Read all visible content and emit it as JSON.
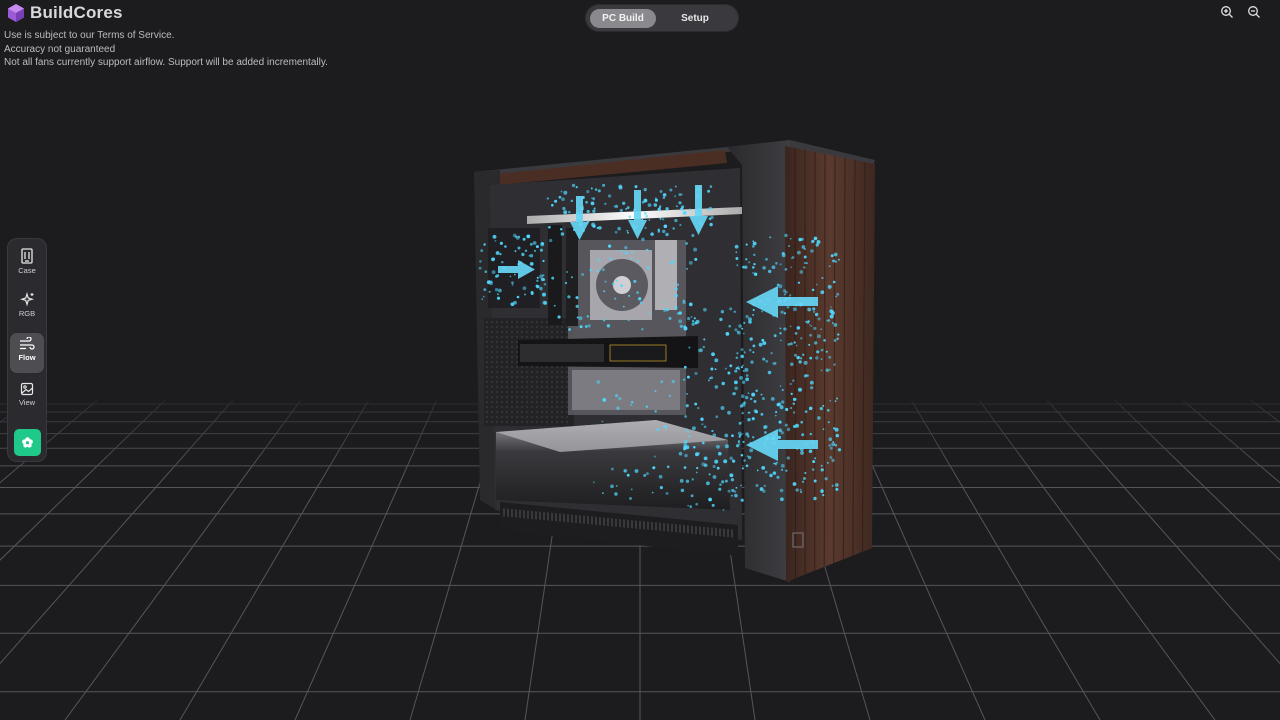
{
  "app": {
    "title": "BuildCores",
    "disclaimers": [
      "Use is subject to our Terms of Service.",
      "Accuracy not guaranteed",
      "Not all fans currently support airflow. Support will be added incrementally."
    ]
  },
  "tabs": [
    {
      "label": "PC Build",
      "active": true
    },
    {
      "label": "Setup",
      "active": false
    }
  ],
  "zoom_controls": {
    "zoom_in_icon": "zoom-in-icon",
    "zoom_out_icon": "zoom-out-icon"
  },
  "toolbar": {
    "items": [
      {
        "label": "Case",
        "icon": "case-icon",
        "active": false
      },
      {
        "label": "RGB",
        "icon": "sparkle-icon",
        "active": false
      },
      {
        "label": "Flow",
        "icon": "wind-icon",
        "active": true
      },
      {
        "label": "View",
        "icon": "image-icon",
        "active": false
      }
    ],
    "extra_button_icon": "flower-icon"
  },
  "colors": {
    "background": "#1c1b1e",
    "grid_line": "#6a6a6e",
    "airflow": "#4fd8ff",
    "accent_green": "#1fc98a",
    "logo_purple": "#9b5bd6",
    "wood_panel": "#4a3028"
  }
}
